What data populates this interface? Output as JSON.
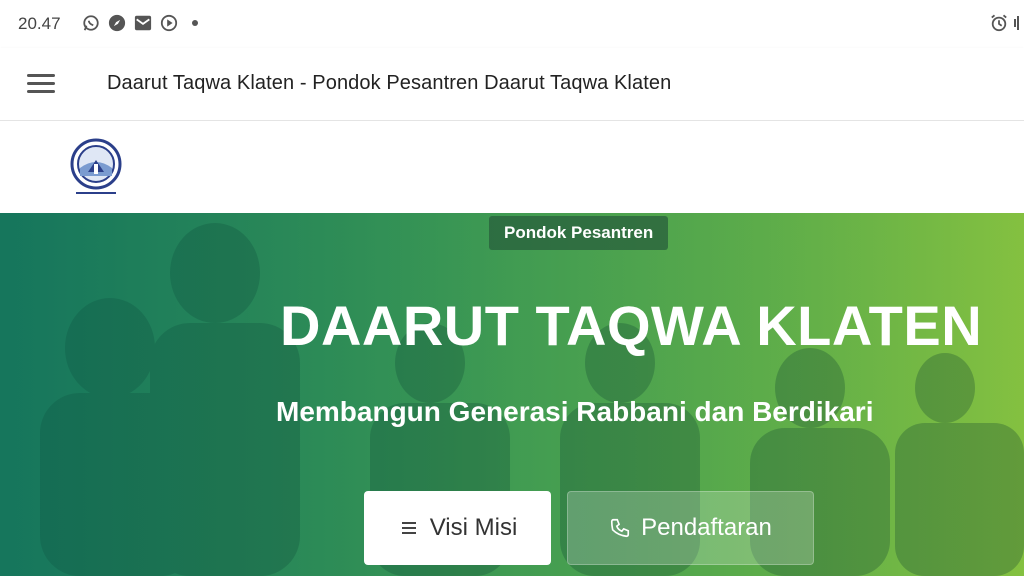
{
  "status_bar": {
    "time": "20.47",
    "left_icons": [
      "whatsapp-icon",
      "compass-icon",
      "mail-icon",
      "play-circle-icon",
      "dot-icon"
    ],
    "right_icons": [
      "alarm-icon",
      "vibrate-icon"
    ]
  },
  "app_bar": {
    "title": "Daarut Taqwa Klaten - Pondok Pesantren Daarut Taqwa Klaten",
    "menu_icon": "hamburger-menu-icon"
  },
  "site": {
    "logo_icon": "school-emblem-icon"
  },
  "hero": {
    "badge": "Pondok Pesantren",
    "title": "DAARUT TAQWA KLATEN",
    "subtitle": "Membangun Generasi Rabbani dan Berdikari",
    "buttons": [
      {
        "label": "Visi Misi",
        "icon": "list-icon"
      },
      {
        "label": "Pendaftaran",
        "icon": "phone-icon"
      }
    ],
    "colors": {
      "gradient_start": "#1f7f5f",
      "gradient_end": "#86c141",
      "badge_bg": "#285f3c"
    }
  }
}
